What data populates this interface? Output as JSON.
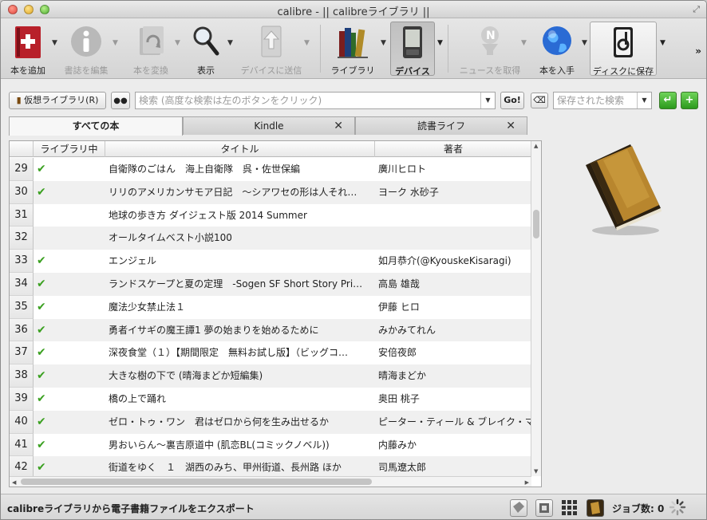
{
  "window": {
    "title": "calibre - || calibreライブラリ ||"
  },
  "toolbar": {
    "add_book": "本を追加",
    "edit_metadata": "書誌を編集",
    "convert": "本を変換",
    "view": "表示",
    "send_to_device": "デバイスに送信",
    "library": "ライブラリ",
    "device": "デバイス",
    "fetch_news": "ニュースを取得",
    "get_books": "本を入手",
    "save_to_disk": "ディスクに保存",
    "more": "»"
  },
  "search": {
    "virtual_library_label": "仮想ライブラリ(R)",
    "placeholder": "検索 (高度な検索は左のボタンをクリック)",
    "go_label": "Go!",
    "saved_search_placeholder": "保存された検索"
  },
  "tabs": [
    {
      "label": "すべての本"
    },
    {
      "label": "Kindle"
    },
    {
      "label": "読書ライフ"
    }
  ],
  "table": {
    "columns": [
      "ライブラリ中",
      "タイトル",
      "著者"
    ],
    "rows": [
      {
        "num": "29",
        "in_library": "✔",
        "title": "自衛隊のごはん　海上自衛隊　呉・佐世保編",
        "author": "廣川ヒロト"
      },
      {
        "num": "30",
        "in_library": "✔",
        "title": "リリのアメリカンサモア日記　～シアワセの形は人それ…",
        "author": "ヨーク 水砂子"
      },
      {
        "num": "31",
        "in_library": "",
        "title": "地球の歩き方 ダイジェスト版 2014 Summer",
        "author": ""
      },
      {
        "num": "32",
        "in_library": "",
        "title": "オールタイムベスト小説100",
        "author": ""
      },
      {
        "num": "33",
        "in_library": "✔",
        "title": "エンジェル",
        "author": "如月恭介(@KyouskeKisaragi)"
      },
      {
        "num": "34",
        "in_library": "✔",
        "title": "ランドスケープと夏の定理　-Sogen SF Short Story Pri…",
        "author": "高島 雄哉"
      },
      {
        "num": "35",
        "in_library": "✔",
        "title": "魔法少女禁止法１",
        "author": "伊藤 ヒロ"
      },
      {
        "num": "36",
        "in_library": "✔",
        "title": "勇者イサギの魔王譚1 夢の始まりを始めるために",
        "author": "みかみてれん"
      },
      {
        "num": "37",
        "in_library": "✔",
        "title": "深夜食堂（１）【期間限定　無料お試し版】（ビッグコ…",
        "author": "安倍夜郎"
      },
      {
        "num": "38",
        "in_library": "✔",
        "title": "大きな樹の下で (晴海まどか短編集)",
        "author": "晴海まどか"
      },
      {
        "num": "39",
        "in_library": "✔",
        "title": "橋の上で踊れ",
        "author": "奥田 桃子"
      },
      {
        "num": "40",
        "in_library": "✔",
        "title": "ゼロ・トゥ・ワン　君はゼロから何を生み出せるか",
        "author": "ピーター・ティール & ブレイク・マスター"
      },
      {
        "num": "41",
        "in_library": "✔",
        "title": "男おいらん〜裏吉原道中 (肌恋BL(コミックノベル))",
        "author": "内藤みか"
      },
      {
        "num": "42",
        "in_library": "✔",
        "title": "街道をゆく　１　湖西のみち、甲州街道、長州路 ほか",
        "author": "司馬遼太郎"
      }
    ]
  },
  "status": {
    "message": "calibreライブラリから電子書籍ファイルをエクスポート",
    "jobs": "ジョブ数: 0"
  },
  "colors": {
    "check": "#3aa020",
    "accent_green": "#2c9a1c"
  }
}
